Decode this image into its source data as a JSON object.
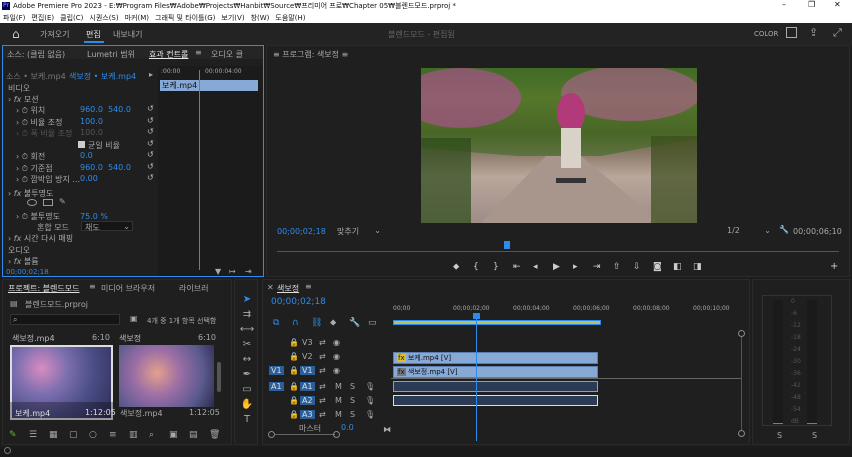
{
  "app": {
    "title": "Adobe Premiere Pro 2023 - E:₩Program Files₩Adobe₩Projects₩Hanbit₩Source₩프리미어 프로₩Chapter 05₩블렌드모드.prproj *"
  },
  "menu": [
    "파일(F)",
    "편집(E)",
    "클립(C)",
    "시퀀스(S)",
    "마커(M)",
    "그래픽 및 타이틀(G)",
    "보기(V)",
    "창(W)",
    "도움말(H)"
  ],
  "window_controls": {
    "minimize": "–",
    "maximize": "❐",
    "close": "✕"
  },
  "workspaces": {
    "tabs": [
      "가져오기",
      "편집",
      "내보내기"
    ],
    "active": "편집",
    "center_title": "블렌드모드 - 편집됨",
    "color_label": "COLOR"
  },
  "effect_controls": {
    "tabs": [
      "소스: (클립 없음)",
      "Lumetri 범위",
      "효과 컨트롤",
      "오디오 클"
    ],
    "source": "소스 • 보케.mp4",
    "clip": "색보정 • 보케.mp4",
    "mini_timeline": {
      "start": ":00:00",
      "end": "00:00:04:00",
      "clip": "보케.mp4"
    },
    "video_header": "비디오",
    "motion": "모션",
    "rows": [
      {
        "label": "위치",
        "values": [
          "960.0",
          "540.0"
        ]
      },
      {
        "label": "비율 조정",
        "values": [
          "100.0"
        ]
      },
      {
        "label": "폭 비율 조정",
        "values": [
          "100.0"
        ]
      },
      {
        "label": "균일 비율",
        "values": []
      },
      {
        "label": "회전",
        "values": [
          "0.0"
        ]
      },
      {
        "label": "기준점",
        "values": [
          "960.0",
          "540.0"
        ]
      },
      {
        "label": "깜박임 방지 ...",
        "values": [
          "0.00"
        ]
      }
    ],
    "opacity": "불투명도",
    "opacity_label": "불투명도",
    "opacity_value": "75.0 %",
    "blend_label": "혼합 모드",
    "blend_value": "채도",
    "time_remap": "시간 다시 매핑",
    "audio_header": "오디오",
    "volume": "볼륨",
    "timecode": "00;00;02;18"
  },
  "program": {
    "title": "프로그램: 색보정",
    "timecode": "00;00;02;18",
    "fit": "맞추기",
    "quality": "1/2",
    "duration": "00;00;06;10"
  },
  "project": {
    "tabs": [
      "프로젝트: 블렌드모드",
      "미디어 브라우저",
      "라이브러"
    ],
    "file": "블렌드모드.prproj",
    "search_placeholder": "",
    "count": "4개 중 1개 항목 선택함",
    "items": [
      {
        "name": "보케.mp4",
        "duration": "1:12:05",
        "top_name": "색보정.mp4",
        "top_duration": "6:10"
      },
      {
        "name": "색보정.mp4",
        "duration": "1:12:05",
        "top_name": "색보정",
        "top_duration": "6:10"
      }
    ]
  },
  "timeline": {
    "title": "색보정",
    "timecode": "00;00;02;18",
    "ruler": [
      "00;00",
      "00;00;02;00",
      "00;00;04;00",
      "00;00;06;00",
      "00;00;08;00",
      "00;00;10;00"
    ],
    "video_tracks": [
      "V3",
      "V2",
      "V1"
    ],
    "audio_tracks": [
      "A1",
      "A2",
      "A3"
    ],
    "src_patch": [
      "V1",
      "A1"
    ],
    "master": "마스터",
    "master_value": "0.0",
    "clips": {
      "v2": "보케.mp4 [V]",
      "v1": "색보정.mp4 [V]"
    }
  },
  "meter": {
    "labels": [
      "0",
      "-6",
      "-12",
      "-18",
      "-24",
      "-30",
      "-36",
      "-42",
      "-48",
      "-54",
      "dB"
    ],
    "solo": [
      "S",
      "S"
    ]
  }
}
